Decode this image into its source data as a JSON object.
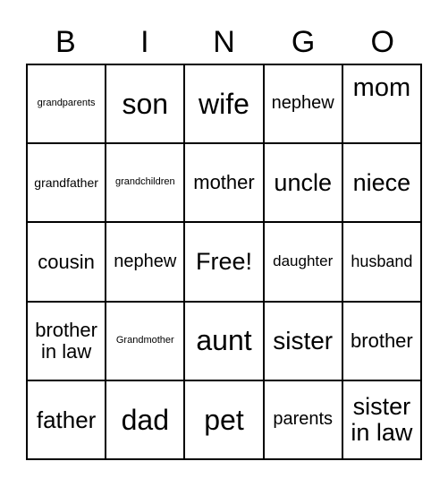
{
  "header": {
    "letters": [
      "B",
      "I",
      "N",
      "G",
      "O"
    ]
  },
  "cells": [
    [
      "grandparents",
      "son",
      "wife",
      "nephew",
      "mom"
    ],
    [
      "grandfather",
      "grandchildren",
      "mother",
      "uncle",
      "niece"
    ],
    [
      "cousin",
      "nephew",
      "Free!",
      "daughter",
      "husband"
    ],
    [
      "brother in law",
      "Grandmother",
      "aunt",
      "sister",
      "brother"
    ],
    [
      "father",
      "dad",
      "pet",
      "parents",
      "sister in law"
    ]
  ]
}
